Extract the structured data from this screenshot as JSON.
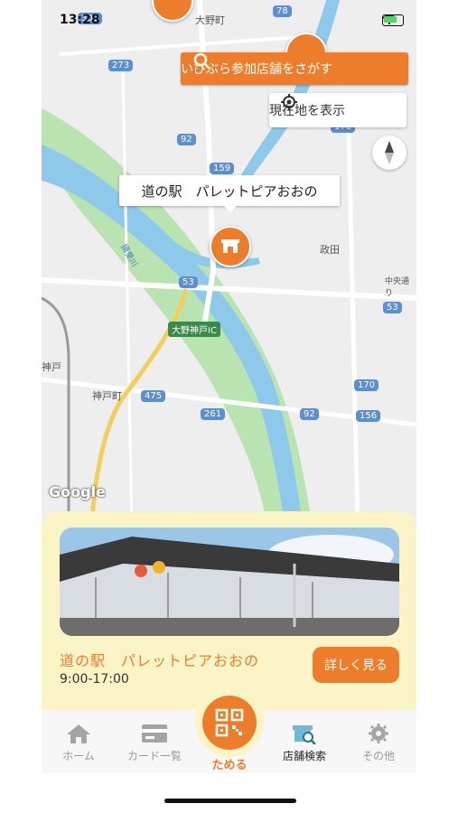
{
  "status_bar": {
    "time": "13:28"
  },
  "map": {
    "search_button": "いびぶら参加店舗をさがす",
    "location_button": "現在地を表示",
    "callout": "道の駅　パレットピアおおの",
    "place_labels": [
      "大野町",
      "政田",
      "神戸町",
      "中央通り",
      "大野神戸IC",
      "揖斐川",
      "神戸"
    ],
    "route_shields": [
      "303",
      "78",
      "273",
      "92",
      "159",
      "170",
      "53",
      "53",
      "475",
      "261",
      "92",
      "170",
      "156"
    ],
    "attribution": "Google"
  },
  "card": {
    "name": "道の駅　パレットピアおおの",
    "hours": "9:00-17:00",
    "detail_button": "詳しく見る"
  },
  "tabs": [
    {
      "label": "ホーム",
      "icon": "home-icon"
    },
    {
      "label": "カード一覧",
      "icon": "card-icon"
    },
    {
      "label": "ためる",
      "icon": "qr-icon"
    },
    {
      "label": "店舗検索",
      "icon": "store-search-icon"
    },
    {
      "label": "その他",
      "icon": "gear-icon"
    }
  ],
  "colors": {
    "accent": "#ee7d2b",
    "card_bg": "#fbf4c6",
    "river": "#8ec9ec",
    "park": "#b9e3b0"
  }
}
